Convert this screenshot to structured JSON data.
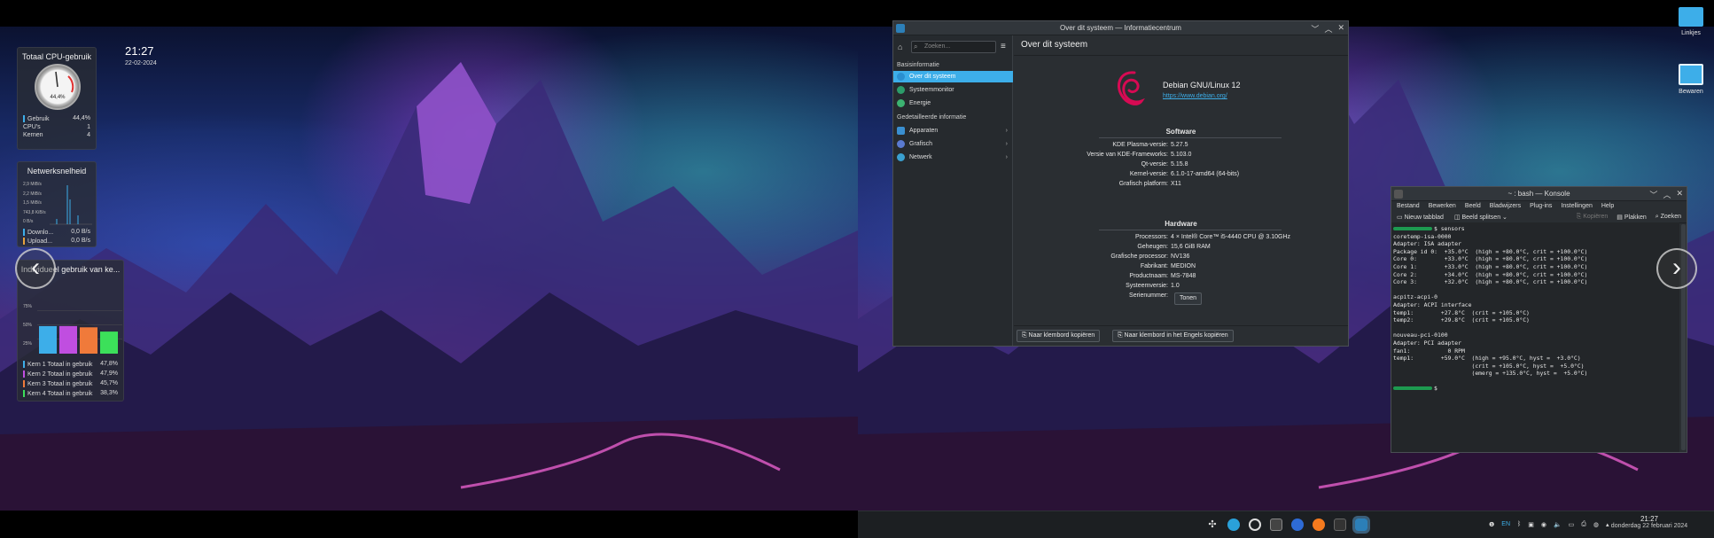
{
  "left_screen": {
    "cpu_widget": {
      "title": "Totaal CPU-gebruik",
      "gauge_label": "44,4%",
      "gauge_value_pct": 44.4,
      "rows": [
        {
          "label": "Gebruik",
          "value": "44,4%"
        },
        {
          "label": "CPU's",
          "value": "1"
        },
        {
          "label": "Kernen",
          "value": "4"
        }
      ]
    },
    "clock": {
      "time": "21:27",
      "date": "22-02-2024"
    },
    "net_widget": {
      "title": "Netwerksnelheid",
      "ticks": [
        "2,9 MiB/s",
        "2,2 MiB/s",
        "1,5 MiB/s",
        "743,8 KiB/s",
        "0 B/s"
      ],
      "rows": [
        {
          "label": "Downlo...",
          "value": "0,0 B/s",
          "color": "#3daee9"
        },
        {
          "label": "Upload...",
          "value": "0,0 B/s",
          "color": "#e6a23c"
        }
      ]
    },
    "core_widget": {
      "title": "Individueel gebruik van ke...",
      "ticks": [
        "75%",
        "50%",
        "25%"
      ],
      "bars": [
        {
          "label": "Kern 1 Totaal in gebruik",
          "value": "47,8%",
          "pct": 47.8,
          "color": "#3daee9"
        },
        {
          "label": "Kern 2 Totaal in gebruik",
          "value": "47,9%",
          "pct": 47.9,
          "color": "#c04ee0"
        },
        {
          "label": "Kern 3 Totaal in gebruik",
          "value": "45,7%",
          "pct": 45.7,
          "color": "#f07a3a"
        },
        {
          "label": "Kern 4 Totaal in gebruik",
          "value": "38,3%",
          "pct": 38.3,
          "color": "#3ce05a"
        }
      ]
    }
  },
  "info_window": {
    "title": "Over dit systeem — Informatiecentrum",
    "search_placeholder": "Zoeken...",
    "page_title": "Over dit systeem",
    "sections": {
      "basis": "Basisinformatie",
      "detail": "Gedetailleerde informatie"
    },
    "basis_items": [
      {
        "label": "Over dit systeem",
        "color": "#3daee9"
      },
      {
        "label": "Systeemmonitor",
        "color": "#2c9c6a"
      },
      {
        "label": "Energie",
        "color": "#3cb371"
      }
    ],
    "detail_items": [
      {
        "label": "Apparaten",
        "color": "#3a8fd0"
      },
      {
        "label": "Grafisch",
        "color": "#5a7ad0"
      },
      {
        "label": "Netwerk",
        "color": "#3aa0d0"
      }
    ],
    "os_name": "Debian GNU/Linux 12",
    "os_link": "https://www.debian.org/",
    "software_heading": "Software",
    "software": [
      {
        "k": "KDE Plasma-versie:",
        "v": "5.27.5"
      },
      {
        "k": "Versie van KDE-Frameworks:",
        "v": "5.103.0"
      },
      {
        "k": "Qt-versie:",
        "v": "5.15.8"
      },
      {
        "k": "Kernel-versie:",
        "v": "6.1.0-17-amd64 (64-bits)"
      },
      {
        "k": "Grafisch platform:",
        "v": "X11"
      }
    ],
    "hardware_heading": "Hardware",
    "hardware": [
      {
        "k": "Processors:",
        "v": "4 × Intel® Core™ i5-4440 CPU @ 3.10GHz"
      },
      {
        "k": "Geheugen:",
        "v": "15,6 GiB RAM"
      },
      {
        "k": "Grafische processor:",
        "v": "NV136"
      },
      {
        "k": "Fabrikant:",
        "v": "MEDION"
      },
      {
        "k": "Productnaam:",
        "v": "MS-7848"
      },
      {
        "k": "Systeemversie:",
        "v": "1.0"
      },
      {
        "k": "Serienummer:",
        "v": ""
      }
    ],
    "show_button": "Tonen",
    "copy_button": "Naar klembord kopiëren",
    "copy_en_button": "Naar klembord in het Engels kopiëren"
  },
  "desktop_icons": [
    {
      "label": "Linkjes"
    },
    {
      "label": "Bewaren"
    }
  ],
  "konsole": {
    "title": "~ : bash — Konsole",
    "menu": [
      "Bestand",
      "Bewerken",
      "Beeld",
      "Bladwijzers",
      "Plug-ins",
      "Instellingen",
      "Help"
    ],
    "toolbar": {
      "new_tab": "Nieuw tabblad",
      "split": "Beeld splitsen",
      "copy": "Kopiëren",
      "paste": "Plakken",
      "find": "Zoeken"
    },
    "lines": [
      "$ sensors",
      "coretemp-isa-0000",
      "Adapter: ISA adapter",
      "Package id 0:  +35.0°C  (high = +80.0°C, crit = +100.0°C)",
      "Core 0:        +33.0°C  (high = +80.0°C, crit = +100.0°C)",
      "Core 1:        +33.0°C  (high = +80.0°C, crit = +100.0°C)",
      "Core 2:        +34.0°C  (high = +80.0°C, crit = +100.0°C)",
      "Core 3:        +32.0°C  (high = +80.0°C, crit = +100.0°C)",
      "",
      "acpitz-acpi-0",
      "Adapter: ACPI interface",
      "temp1:        +27.8°C  (crit = +105.0°C)",
      "temp2:        +29.8°C  (crit = +105.0°C)",
      "",
      "nouveau-pci-0100",
      "Adapter: PCI adapter",
      "fan1:           0 RPM",
      "temp1:        +59.0°C  (high = +95.0°C, hyst =  +3.0°C)",
      "                       (crit = +105.0°C, hyst =  +5.0°C)",
      "                       (emerg = +135.0°C, hyst =  +5.0°C)",
      "",
      "$ "
    ]
  },
  "taskbar": {
    "lang": "EN",
    "time": "21:27",
    "date": "donderdag 22 februari 2024"
  }
}
